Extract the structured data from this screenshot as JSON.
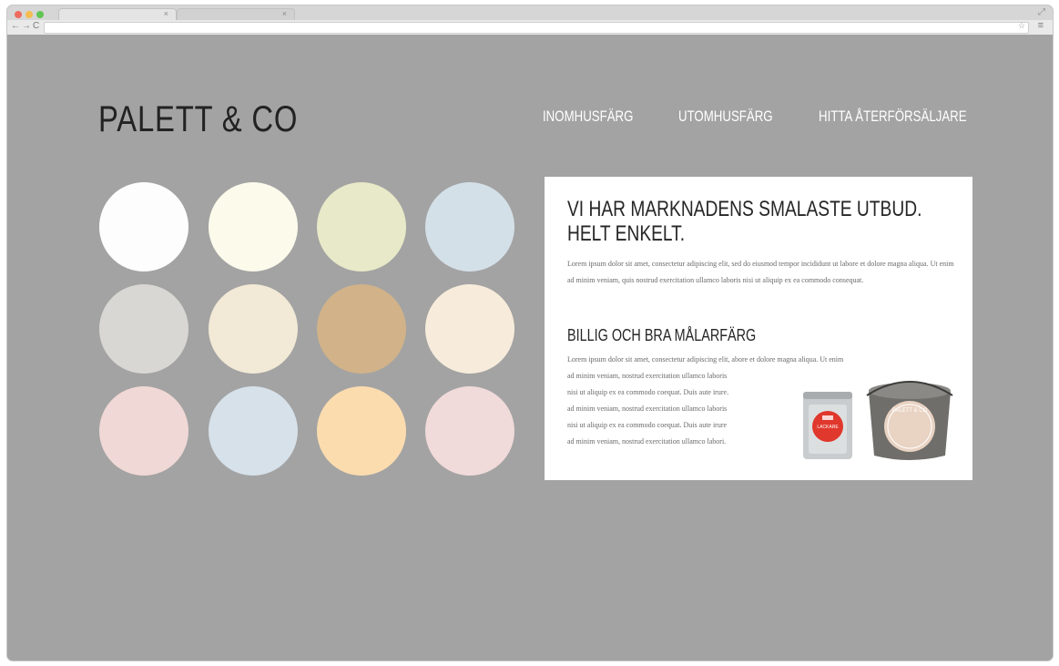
{
  "browser": {
    "url": ""
  },
  "logo": "PALETT & CO",
  "nav": [
    {
      "label": "INOMHUSFÄRG"
    },
    {
      "label": "UTOMHUSFÄRG"
    },
    {
      "label": "HITTA ÅTERFÖRSÄLJARE"
    }
  ],
  "swatches": [
    {
      "color": "#fdfdfd"
    },
    {
      "color": "#fbfaeb"
    },
    {
      "color": "#e8e9c8"
    },
    {
      "color": "#d4e0e8"
    },
    {
      "color": "#d8d7d4"
    },
    {
      "color": "#f2e9d6"
    },
    {
      "color": "#d1b289"
    },
    {
      "color": "#f7ecdb"
    },
    {
      "color": "#f0d8d6"
    },
    {
      "color": "#d6e1ea"
    },
    {
      "color": "#fbdcaf"
    },
    {
      "color": "#f1dada"
    }
  ],
  "card": {
    "title_line1": "VI HAR MARKNADENS SMALASTE UTBUD.",
    "title_line2": "HELT ENKELT.",
    "body": "Lorem ipsum dolor sit amet, consectetur adipiscing elit, sed do eiusmod tempor incididunt ut labore et dolore magna aliqua. Ut enim ad minim veniam, quis nostrud exercitation ullamco laboris nisi ut aliquip ex ea commodo consequat.",
    "subtitle": "BILLIG OCH BRA MÅLARFÄRG",
    "body2_lines": [
      "Lorem ipsum dolor sit amet, consectetur adipiscing elit, abore et dolore magna aliqua. Ut enim",
      "ad minim veniam, nostrud exercitation ullamco laboris",
      "nisi ut aliquip ex ea commodo coequat. Duis aute irure.",
      "ad minim veniam, nostrud exercitation ullamco laboris",
      "nisi ut aliquip ex ea commodo coequat. Duis aute irure",
      "ad minim veniam, nostrud exercitation ullamco labori."
    ],
    "product_label_small": "LACKARE",
    "product_brand": "PALETT & CO"
  }
}
